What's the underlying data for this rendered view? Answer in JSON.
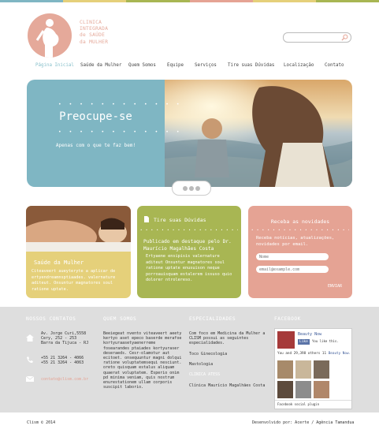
{
  "colors": {
    "teal": "#7fb6c3",
    "yellow": "#e5d07a",
    "green": "#a8b653",
    "salmon": "#e5a394",
    "footer": "#dedede"
  },
  "logo": {
    "line1": "CLINICA",
    "line2": "INTEGRADA",
    "line3": "de SAÚDE",
    "line4": "da MULHER",
    "icon": "pregnant-woman-icon"
  },
  "search": {
    "placeholder": "",
    "icon": "search-icon"
  },
  "nav": [
    "Página Inicial",
    "Saúde da Mulher",
    "Quem Somos",
    "Equipe",
    "Serviços",
    "Tire suas Dúvidas",
    "Localização",
    "Contato"
  ],
  "hero": {
    "title": "Preocupe-se",
    "subtitle": "Apenas com o que te faz bem!"
  },
  "card1": {
    "title": "Saúde da Mulher",
    "body": "Citeaveert aueyteryte a aplicar de ertyendreamnsptiaades. valernature aditeut. Onsuntur magnatores soul ratione uptate."
  },
  "card2": {
    "header": "Tire suas Dúvidas",
    "title": "Publicado em destaque pelo Dr. Maurício Magalhães Costa",
    "body": "Ertyaene ensipisis valernature aditeut Onsuntur magnatores soul ratione uptate enusuison neque porroauisquam estalerem issuso quio dolorer ntrolereso."
  },
  "card3": {
    "header": "Receba as novidades",
    "body": "Receba notícias, atualizações, novidades por email.",
    "name_placeholder": "Nome",
    "email_placeholder": "email@example.com",
    "submit": "ENVIAR"
  },
  "footer": {
    "contacts_title": "NOSSOS CONTATOS",
    "address": [
      "Av. Jorge Curi,5558",
      "Cery, 252 - 253",
      "Barra da Tijuca - RJ"
    ],
    "phones": [
      "+55 21 3264 - 4066",
      "+55 21 3264 - 4063"
    ],
    "email": "contato@clism.com.br",
    "about_title": "QUEM SOMOS",
    "about_body": "Beeiegeat nvento viteaveert aeety kertyo aset epeco baserde merafoe kortyuraasetyaenerreme fosearandes ptaiades kortyuraser deseraeds. Cesr-olamotur aut ecitoet. onsequuntur magni dolqui ratione voluptatemsequi nesciunt. oreto quisquam estalus aliquam quaerat voluptatem. Esperio onim pd minima veniam, quis nostrum enurestationem ullam corporis suscipit laborio.",
    "specialties_title": "ESPECIALIDADES",
    "specialties_body": "Com foco em Medicina da Mulher a CLISM possui as seguintes especialidades.",
    "specialties": [
      "Toco Ginecologia",
      "Mastologia"
    ],
    "staff_title": "CLINICA ATESS",
    "staff_name": "Clínica Maurício Magalhães Costa",
    "facebook_title": "FACEBOOK",
    "fb_page": "Beauty Now",
    "fb_like": "Like",
    "fb_like_page": "You like this.",
    "fb_count": "You and 29,398 others 11",
    "fb_count_tail": "Beauty Now.",
    "fb_plugin": "Facebook social plugin"
  },
  "bottom": {
    "left": "Clism © 2014",
    "right": "Desenvolvido por: Acerte / Agência Tamandua"
  }
}
